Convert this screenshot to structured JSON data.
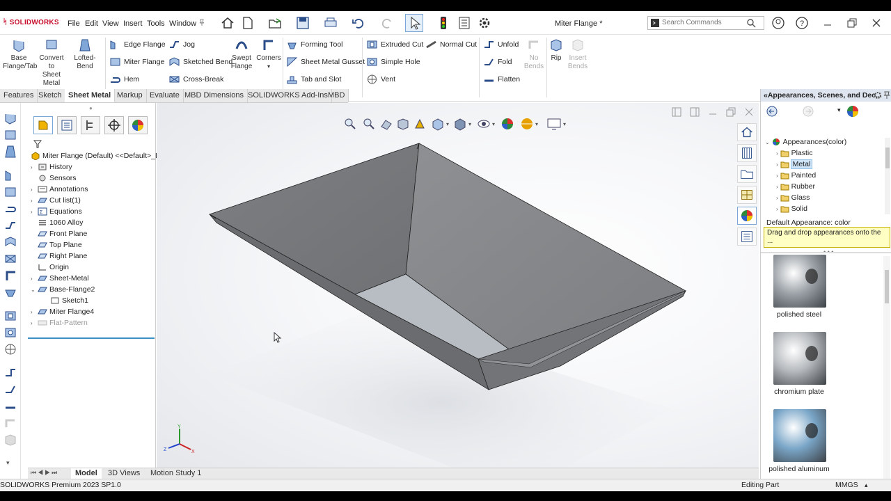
{
  "app": {
    "brand": "SOLIDWORKS",
    "document_title": "Miter Flange *",
    "menus": [
      "File",
      "Edit",
      "View",
      "Insert",
      "Tools",
      "Window"
    ],
    "search_placeholder": "Search Commands"
  },
  "ribbon": {
    "big_buttons": [
      {
        "label_lines": [
          "Base",
          "Flange/Tab"
        ],
        "icon": "base-flange-icon"
      },
      {
        "label_lines": [
          "Convert",
          "to",
          "Sheet",
          "Metal"
        ],
        "icon": "convert-icon"
      },
      {
        "label_lines": [
          "Lofted-Bend"
        ],
        "icon": "lofted-bend-icon"
      }
    ],
    "col1": [
      "Edge Flange",
      "Miter Flange",
      "Hem"
    ],
    "col2": [
      "Jog",
      "Sketched Bend",
      "Cross-Break"
    ],
    "swept_flange": [
      "Swept",
      "Flange"
    ],
    "corners": "Corners",
    "col3": [
      "Forming Tool",
      "Sheet Metal Gusset",
      "Tab and Slot"
    ],
    "col4": [
      "Extruded Cut",
      "Simple Hole",
      "Vent"
    ],
    "normal_cut": "Normal Cut",
    "col5": [
      "Unfold",
      "Fold",
      "Flatten"
    ],
    "no_bends": [
      "No",
      "Bends"
    ],
    "rip": "Rip",
    "insert_bends": [
      "Insert",
      "Bends"
    ]
  },
  "tabs": [
    "Features",
    "Sketch",
    "Sheet Metal",
    "Markup",
    "Evaluate",
    "MBD Dimensions",
    "SOLIDWORKS Add-Ins",
    "MBD"
  ],
  "active_tab": "Sheet Metal",
  "feature_tree": {
    "root": "Miter Flange (Default) <<Default>_D",
    "items": [
      {
        "label": "History",
        "expandable": true
      },
      {
        "label": "Sensors",
        "expandable": false
      },
      {
        "label": "Annotations",
        "expandable": true
      },
      {
        "label": "Cut list(1)",
        "expandable": true
      },
      {
        "label": "Equations",
        "expandable": true
      },
      {
        "label": "1060 Alloy",
        "expandable": false
      },
      {
        "label": "Front Plane",
        "expandable": false
      },
      {
        "label": "Top Plane",
        "expandable": false
      },
      {
        "label": "Right Plane",
        "expandable": false
      },
      {
        "label": "Origin",
        "expandable": false
      },
      {
        "label": "Sheet-Metal",
        "expandable": true
      },
      {
        "label": "Base-Flange2",
        "expandable": true
      },
      {
        "label": "Sketch1",
        "expandable": false
      },
      {
        "label": "Miter Flange4",
        "expandable": true
      },
      {
        "label": "Flat-Pattern",
        "expandable": true
      }
    ]
  },
  "right_panel": {
    "header": "Appearances, Scenes, and Dec...",
    "root": "Appearances(color)",
    "categories": [
      "Plastic",
      "Metal",
      "Painted",
      "Rubber",
      "Glass",
      "Solid"
    ],
    "selected": "Metal",
    "default_appearance": "Default Appearance: color",
    "tooltip": "Drag and drop appearances onto the ...",
    "swatches": [
      {
        "label": "polished steel",
        "color": "#9aa0a6"
      },
      {
        "label": "chromium plate",
        "color": "#b4b8bc"
      },
      {
        "label": "polished aluminum",
        "color": "#7aa6c8"
      }
    ]
  },
  "bottom_tabs": [
    "Model",
    "3D Views",
    "Motion Study 1"
  ],
  "active_bottom_tab": "Model",
  "status": {
    "left": "SOLIDWORKS Premium 2023 SP1.0",
    "mode": "Editing Part",
    "units": "MMGS"
  },
  "triad": {
    "x": "X",
    "y": "Y",
    "z": "Z"
  }
}
